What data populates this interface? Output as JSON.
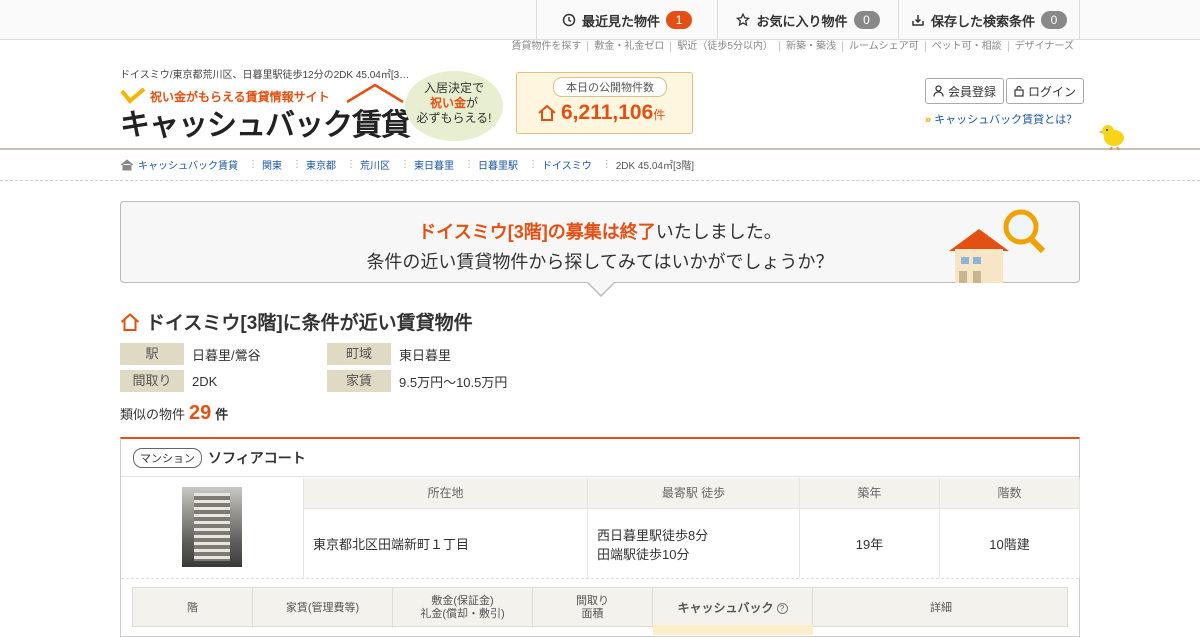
{
  "topnav": {
    "recent": {
      "label": "最近見た物件",
      "count": "1"
    },
    "fav": {
      "label": "お気に入り物件",
      "count": "0"
    },
    "saved": {
      "label": "保存した検索条件",
      "count": "0"
    }
  },
  "sublinks": [
    "賃貸物件を探す",
    "敷金・礼金ゼロ",
    "駅近（徒歩5分以内）",
    "新築・築浅",
    "ルームシェア可",
    "ペット可・相談",
    "デザイナーズ"
  ],
  "header": {
    "page_title": "ドイスミウ/東京都荒川区、日暮里駅徒歩12分の2DK 45.04㎡[3…",
    "logo_tag": "祝い金がもらえる賃貸情報サイト",
    "logo_main": "キャッシュバック賃貸",
    "bubble_l1": "入居決定で",
    "bubble_l2": "祝い金",
    "bubble_l2b": "が",
    "bubble_l3": "必ずもらえる!",
    "count_label": "本日の公開物件数",
    "count_value": "6,211,106",
    "count_unit": "件",
    "register": "会員登録",
    "login": "ログイン",
    "about": "キャッシュバック賃貸とは？"
  },
  "breadcrumb": [
    "キャッシュバック賃貸",
    "関東",
    "東京都",
    "荒川区",
    "東日暮里",
    "日暮里駅",
    "ドイスミウ"
  ],
  "breadcrumb_current": "2DK 45.04㎡[3階]",
  "notice": {
    "highlight": "ドイスミウ[3階]の募集は終了",
    "rest": "いたしました。",
    "line2": "条件の近い賃貸物件から探してみてはいかがでしょうか？"
  },
  "section_title": "ドイスミウ[3階]に条件が近い賃貸物件",
  "conditions": {
    "station_k": "駅",
    "station_v": "日暮里/鶯谷",
    "town_k": "町域",
    "town_v": "東日暮里",
    "layout_k": "間取り",
    "layout_v": "2DK",
    "rent_k": "家賃",
    "rent_v": "9.5万円～10.5万円"
  },
  "similar": {
    "label": "類似の物件",
    "count": "29",
    "unit": "件"
  },
  "property": {
    "type": "マンション",
    "name": "ソフィアコート",
    "h_addr": "所在地",
    "h_station": "最寄駅 徒歩",
    "h_age": "築年",
    "h_floors": "階数",
    "addr": "東京都北区田端新町１丁目",
    "station1": "西日暮里駅徒歩8分",
    "station2": "田端駅徒歩10分",
    "age": "19年",
    "floors": "10階建",
    "rh_floor": "階",
    "rh_rent": "家賃(管理費等)",
    "rh_dep1": "敷金(保証金)",
    "rh_dep2": "礼金(償却・敷引)",
    "rh_lay1": "間取り",
    "rh_lay2": "面積",
    "rh_cb": "キャッシュバック",
    "rh_detail": "詳細"
  },
  "colors": {
    "accent": "#e25113",
    "link": "#1a55a3"
  }
}
